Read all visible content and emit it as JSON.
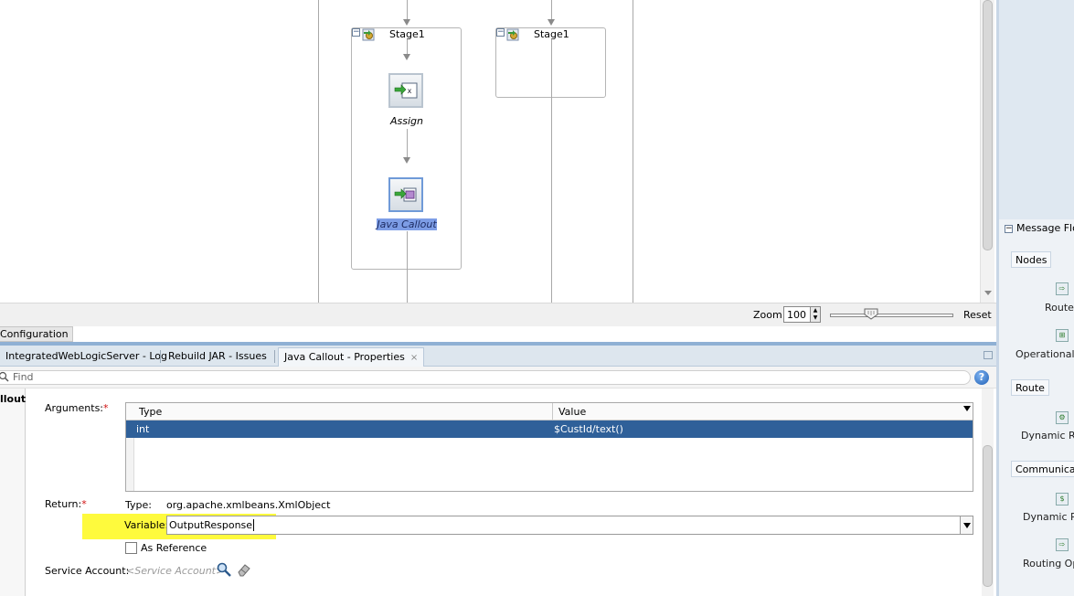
{
  "canvas": {
    "stages": [
      {
        "label": "Stage1"
      },
      {
        "label": "Stage1"
      }
    ],
    "nodes": {
      "assign_label": "Assign",
      "java_callout_label": "Java Callout"
    }
  },
  "zoom": {
    "label": "Zoom:",
    "value": "100",
    "reset_label": "Reset"
  },
  "config_tab": {
    "label": "Configuration"
  },
  "tabs": [
    {
      "label": "IntegratedWebLogicServer - Log"
    },
    {
      "label": "Rebuild JAR - Issues"
    },
    {
      "label": "Java Callout - Properties",
      "close": "×"
    }
  ],
  "find": {
    "placeholder": "Find",
    "help": "?"
  },
  "properties": {
    "section_label": "llout",
    "arguments_label": "Arguments:",
    "required_mark": "*",
    "grid": {
      "columns": [
        "Type",
        "Value"
      ],
      "rows": [
        {
          "type": "int",
          "value": "$CustId/text()"
        }
      ]
    },
    "return_label": "Return:",
    "type_label": "Type:",
    "type_value": "org.apache.xmlbeans.XmlObject",
    "variable_label": "Variable:",
    "variable_value": "OutputResponse",
    "as_reference_label": "As Reference",
    "service_account_label": "Service Account:",
    "service_account_placeholder": "<Service Account>"
  },
  "palette": {
    "title": "Message Flow",
    "sections": [
      {
        "label": "Nodes",
        "items": [
          {
            "label": "Route"
          },
          {
            "label": "Operational B"
          }
        ]
      },
      {
        "label": "Route",
        "items": [
          {
            "label": "Dynamic Ro"
          }
        ]
      },
      {
        "label": "Communicatio",
        "items": [
          {
            "label": "Dynamic Pu"
          },
          {
            "label": "Routing Opt"
          }
        ]
      }
    ]
  },
  "colors": {
    "selection": "#2f6099",
    "highlight": "#fefa3d",
    "required": "#d01010",
    "node_selected_label": "#7d9de6"
  }
}
